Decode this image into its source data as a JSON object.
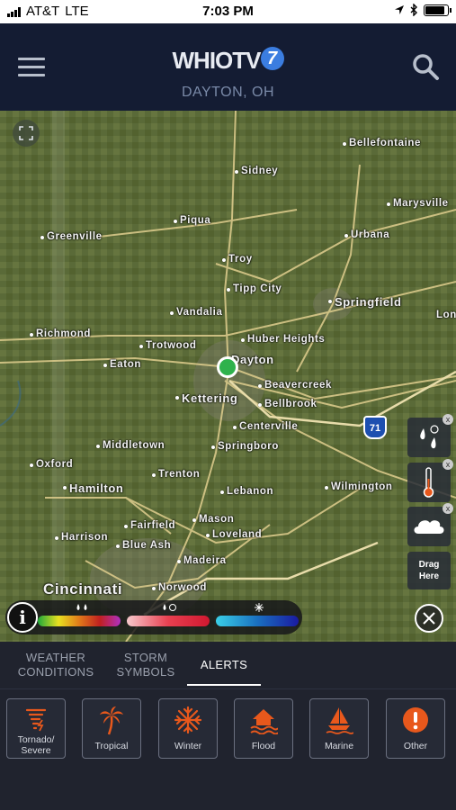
{
  "status_bar": {
    "carrier": "AT&T",
    "network": "LTE",
    "time": "7:03 PM",
    "battery_level": 0.9
  },
  "header": {
    "logo_text": "WHIOTV",
    "logo_number": "7",
    "location": "DAYTON, OH",
    "menu_icon": "hamburger-icon",
    "search_icon": "search-icon"
  },
  "map": {
    "cities": [
      "Bellefontaine",
      "Sidney",
      "Marysville",
      "Piqua",
      "Greenville",
      "Urbana",
      "Troy",
      "Tipp City",
      "Springfield",
      "Vandalia",
      "Lon",
      "Richmond",
      "Trotwood",
      "Huber Heights",
      "Eaton",
      "Dayton",
      "Beavercreek",
      "Kettering",
      "Bellbrook",
      "Centerville",
      "Middletown",
      "Springboro",
      "Oxford",
      "Trenton",
      "Hamilton",
      "Lebanon",
      "Wilmington",
      "Mason",
      "Fairfield",
      "Loveland",
      "Harrison",
      "Blue Ash",
      "Madeira",
      "Cincinnati",
      "Norwood"
    ],
    "interstate_label": "71",
    "drag_label_1": "Drag",
    "drag_label_2": "Here",
    "tool_close": "x",
    "info_label": "i",
    "legend_colors": {
      "rain": [
        "#1fa83a",
        "#e8e020",
        "#e07a1a",
        "#c02020",
        "#b030c0"
      ],
      "mix": [
        "#f7c8cc",
        "#e84050",
        "#d01830"
      ],
      "snow": [
        "#3ad0e8",
        "#1a70c0",
        "#1a1aa0"
      ]
    }
  },
  "tabs": [
    {
      "label_1": "WEATHER",
      "label_2": "CONDITIONS"
    },
    {
      "label_1": "STORM",
      "label_2": "SYMBOLS"
    },
    {
      "label_1": "ALERTS",
      "label_2": ""
    }
  ],
  "alerts": [
    {
      "label_1": "Tornado/",
      "label_2": "Severe",
      "icon": "tornado-icon"
    },
    {
      "label_1": "Tropical",
      "icon": "palm-tree-icon"
    },
    {
      "label_1": "Winter",
      "icon": "snowflake-icon"
    },
    {
      "label_1": "Flood",
      "icon": "flood-house-icon"
    },
    {
      "label_1": "Marine",
      "icon": "sailboat-icon"
    },
    {
      "label_1": "Other",
      "icon": "exclamation-icon"
    }
  ],
  "accent_color": "#e8581c"
}
